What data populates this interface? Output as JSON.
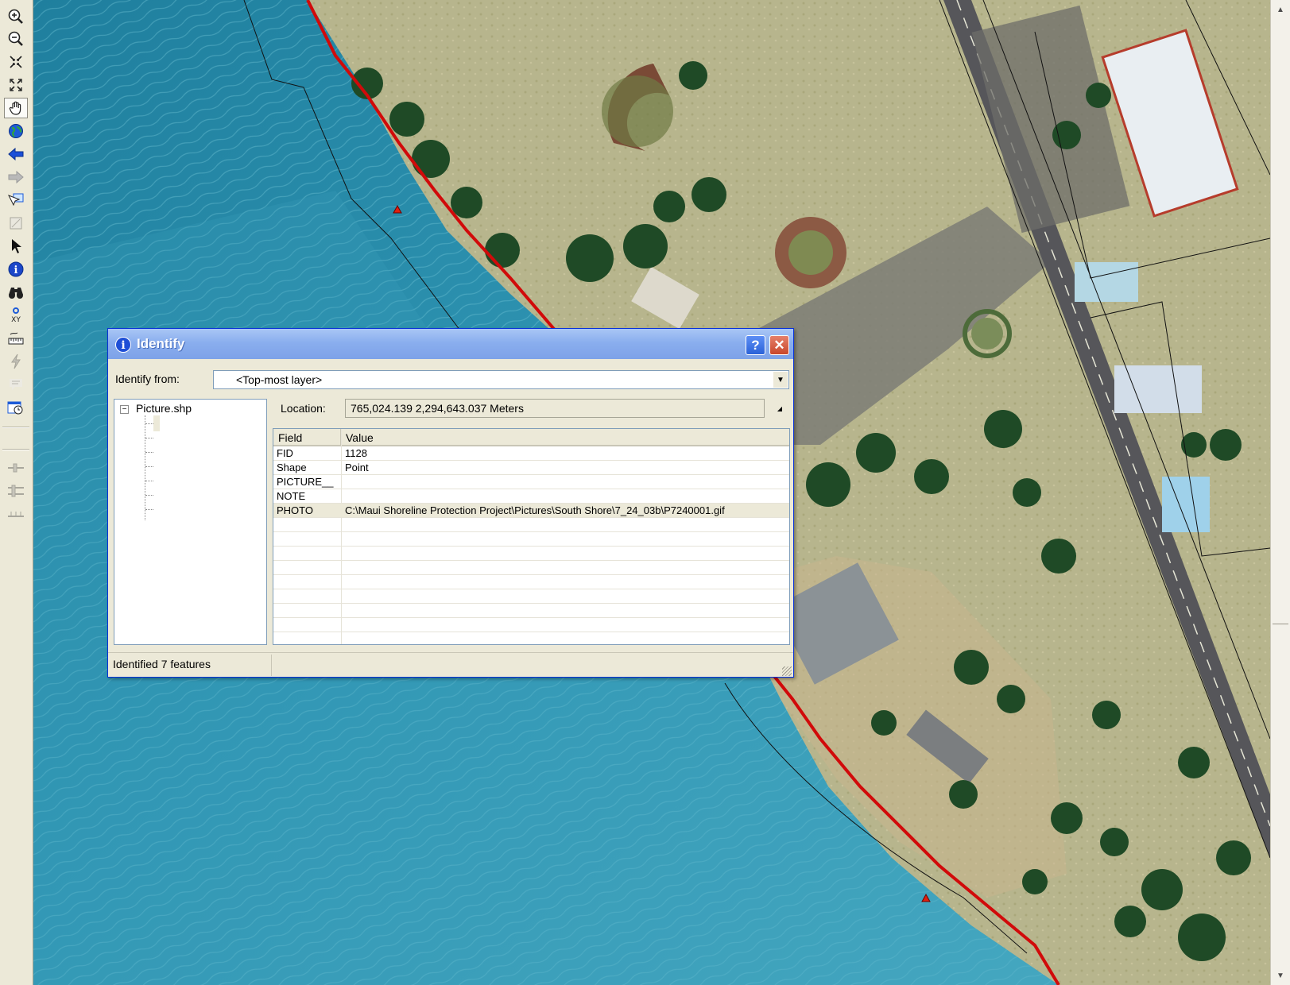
{
  "toolbar": {
    "tools": [
      {
        "icon": "zoom-in-icon"
      },
      {
        "icon": "zoom-out-icon"
      },
      {
        "icon": "fixed-zoom-in-icon"
      },
      {
        "icon": "fixed-zoom-out-icon"
      },
      {
        "icon": "pan-hand-icon",
        "active": true
      },
      {
        "icon": "full-extent-globe-icon"
      },
      {
        "icon": "back-arrow-icon"
      },
      {
        "icon": "forward-arrow-icon"
      },
      {
        "icon": "select-features-icon"
      },
      {
        "icon": "clear-selection-icon"
      },
      {
        "icon": "select-elements-pointer-icon"
      },
      {
        "icon": "identify-info-icon"
      },
      {
        "icon": "find-binoculars-icon"
      },
      {
        "icon": "go-to-xy-icon",
        "label": "XY"
      },
      {
        "icon": "measure-ruler-icon"
      },
      {
        "icon": "hyperlink-lightning-icon"
      },
      {
        "icon": "html-popup-icon"
      },
      {
        "icon": "time-slider-icon"
      },
      {
        "icon": "effects-slider-1-icon"
      },
      {
        "icon": "effects-slider-2-icon"
      },
      {
        "icon": "effects-slider-3-icon"
      }
    ]
  },
  "identify": {
    "title": "Identify",
    "help_label": "?",
    "close_label": "✕",
    "identify_from_label": "Identify from:",
    "identify_from_value": "<Top-most layer>",
    "layer_name": "Picture.shp",
    "location_label": "Location:",
    "location_value": "765,024.139  2,294,643.037 Meters",
    "columns": [
      "Field",
      "Value"
    ],
    "rows": [
      {
        "field": "FID",
        "value": "1128"
      },
      {
        "field": "Shape",
        "value": "Point"
      },
      {
        "field": "PICTURE__",
        "value": ""
      },
      {
        "field": "NOTE",
        "value": ""
      },
      {
        "field": "PHOTO",
        "value": "C:\\Maui Shoreline Protection Project\\Pictures\\South Shore\\7_24_03b\\P7240001.gif"
      }
    ],
    "status": "Identified 7 features"
  },
  "colors": {
    "ocean": "#2a8aa6",
    "shoreline": "#d10a0a",
    "titlebar": "#7da2e8"
  }
}
